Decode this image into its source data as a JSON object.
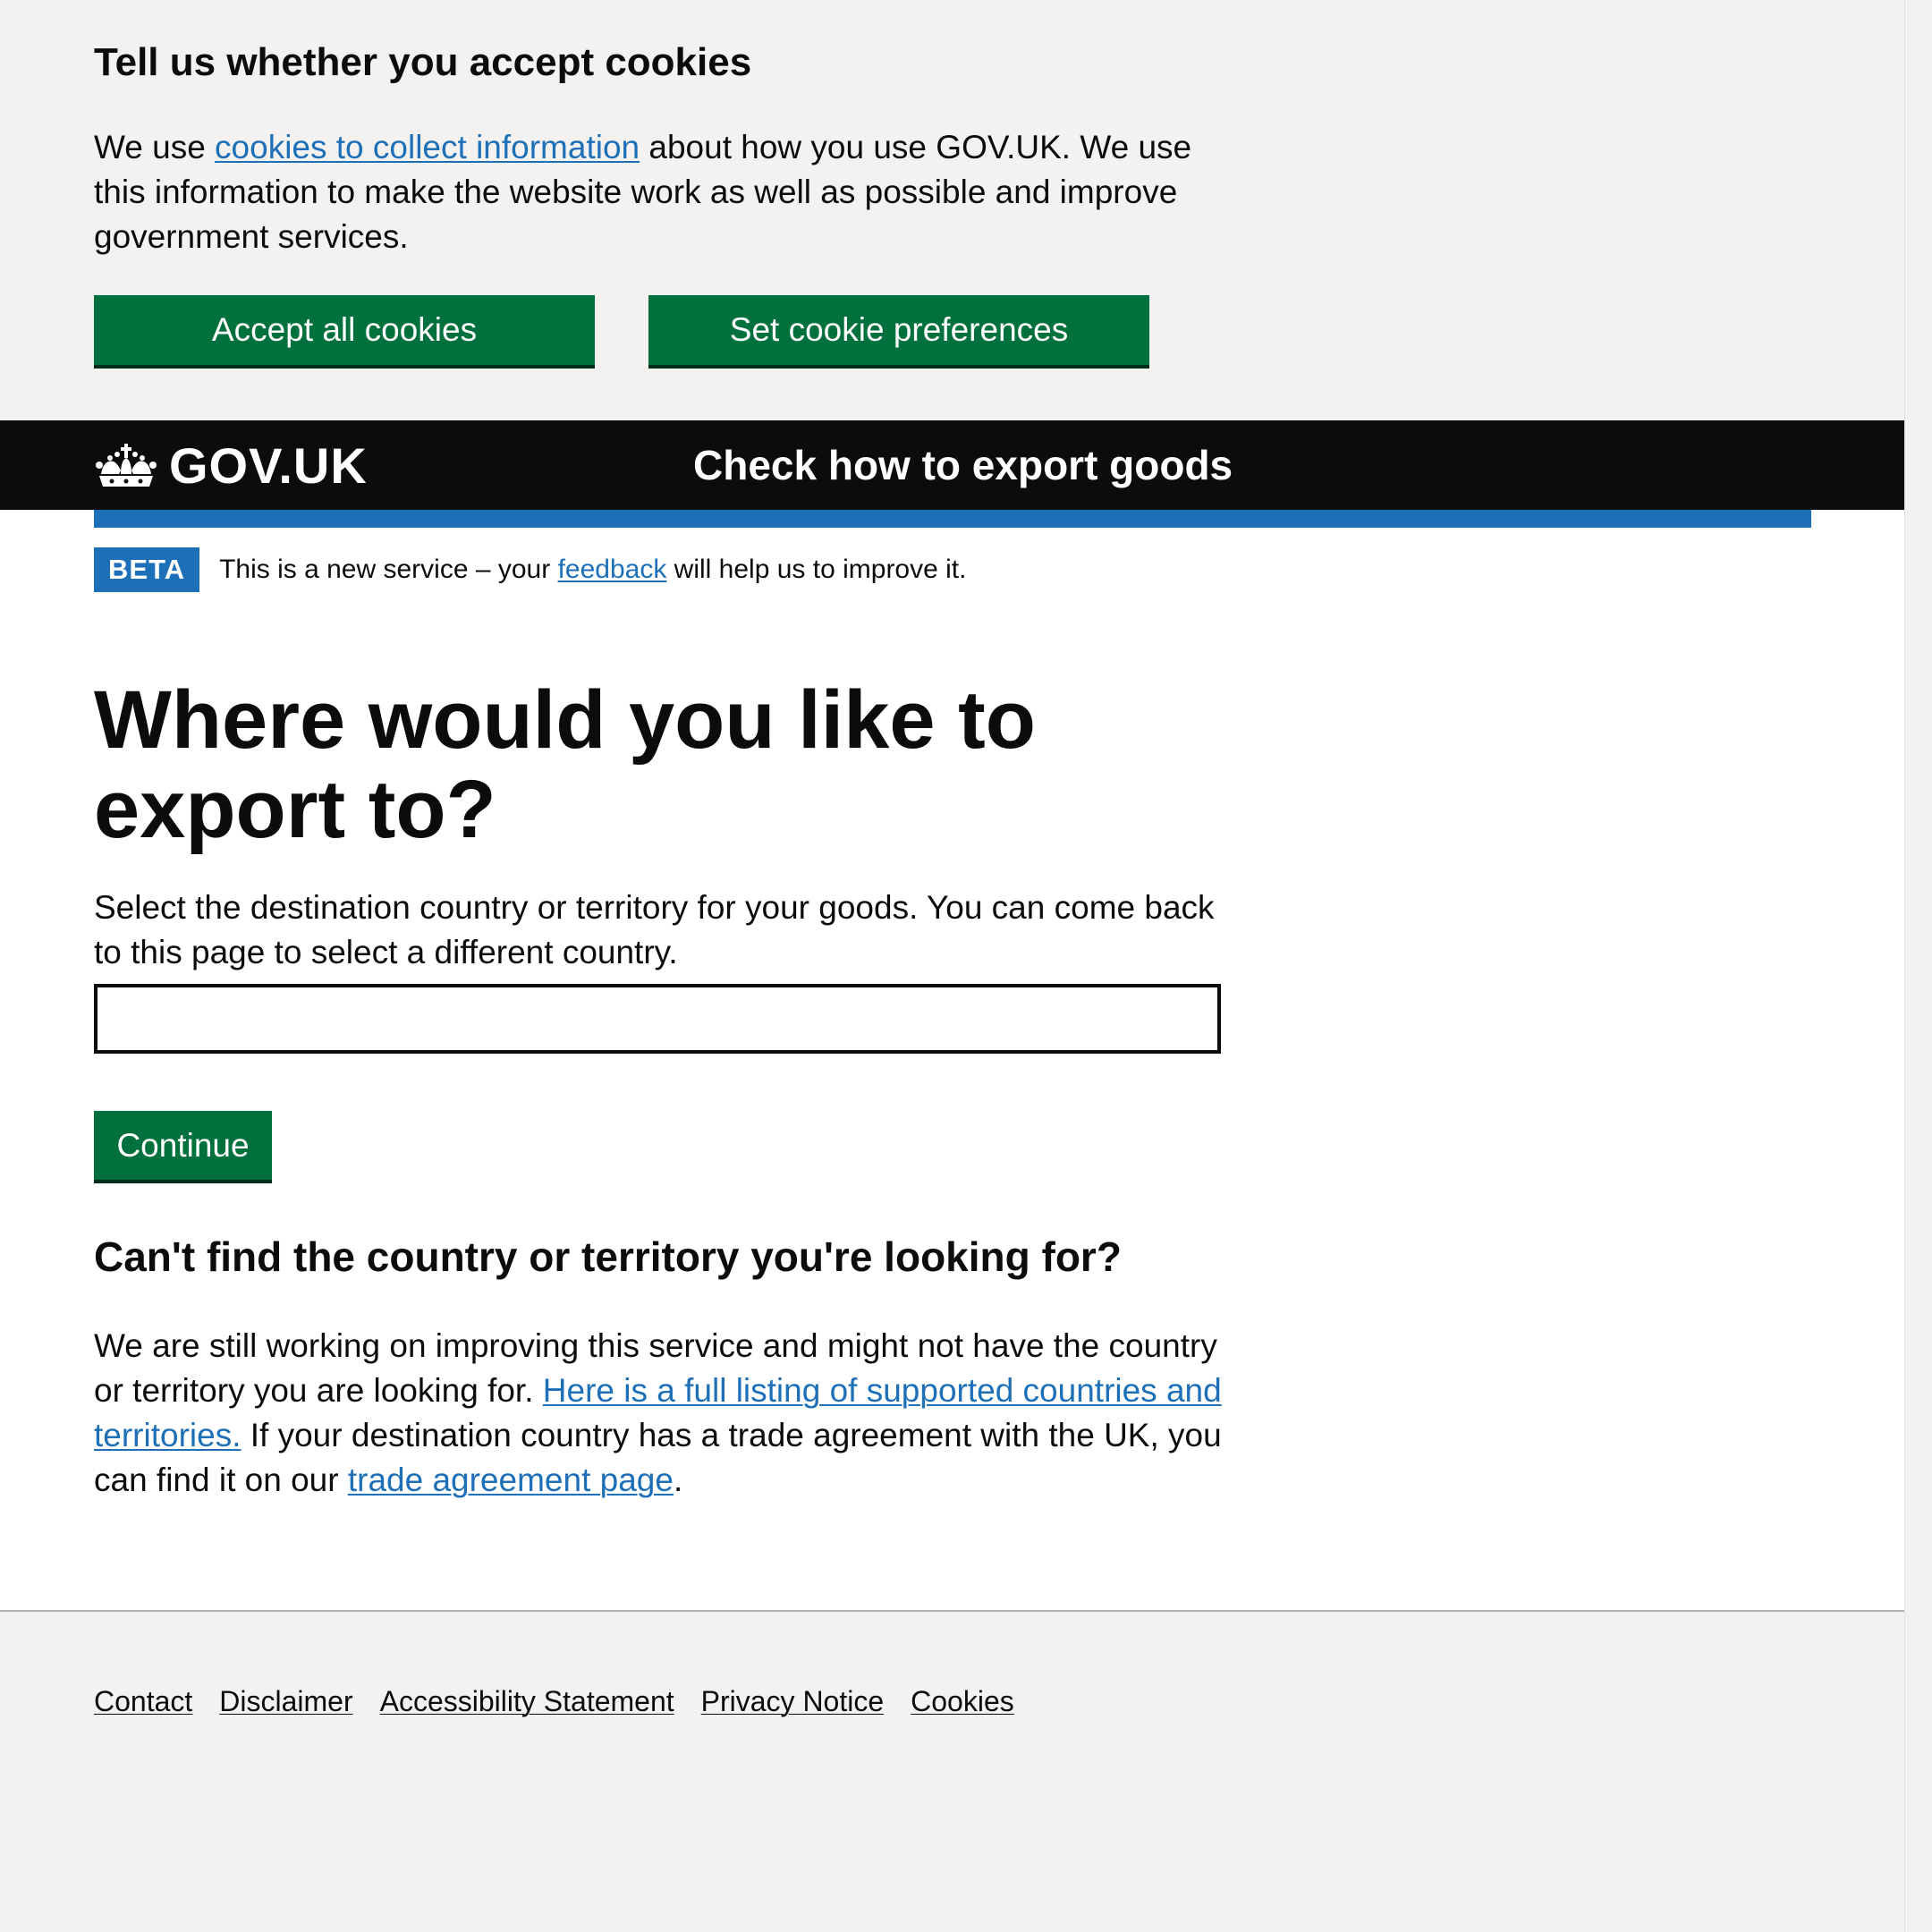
{
  "cookie_banner": {
    "title": "Tell us whether you accept cookies",
    "text_before": "We use ",
    "link": "cookies to collect information",
    "text_after": " about how you use GOV.UK. We use this information to make the website work as well as possible and improve government services.",
    "accept_label": "Accept all cookies",
    "preferences_label": "Set cookie preferences"
  },
  "header": {
    "logo_text": "GOV.UK",
    "service_name": "Check how to export goods"
  },
  "phase_banner": {
    "tag": "BETA",
    "text_before": "This is a new service – your ",
    "link": "feedback",
    "text_after": " will help us to improve it."
  },
  "main": {
    "heading": "Where would you like to export to?",
    "hint": "Select the destination country or territory for your goods. You can come back to this page to select a different country.",
    "input_value": "",
    "continue_label": "Continue",
    "subheading": "Can't find the country or territory you're looking for?",
    "body_before": "We are still working on improving this service and might not have the country or territory you are looking for. ",
    "listing_link": "Here is a full listing of supported countries and territories.",
    "body_middle": " If your destination country has a trade agreement with the UK, you can find it on our ",
    "trade_link": "trade agreement page",
    "body_end": "."
  },
  "footer": {
    "links": [
      "Contact",
      "Disclaimer",
      "Accessibility Statement",
      "Privacy Notice",
      "Cookies"
    ]
  },
  "colors": {
    "link": "#1d70b8",
    "button_green": "#00703c",
    "header_black": "#0b0c0c",
    "beta_blue": "#1d70b8",
    "background_grey": "#f3f2f1"
  }
}
